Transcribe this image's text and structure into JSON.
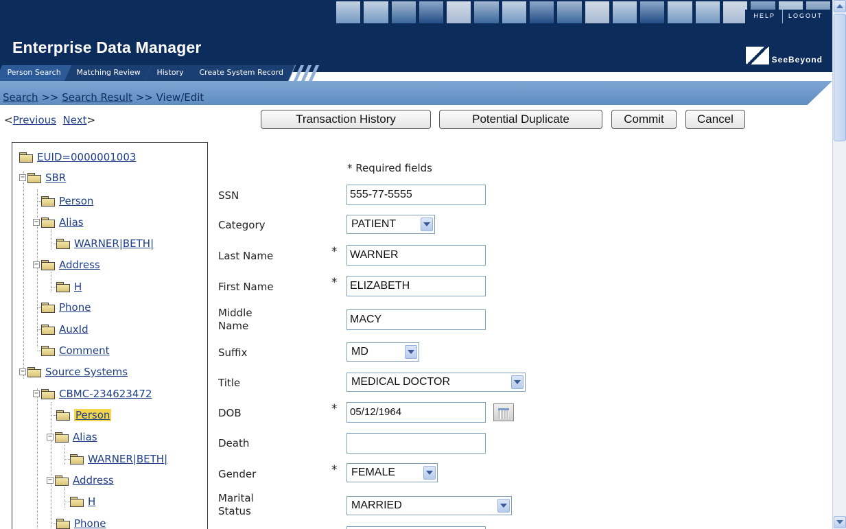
{
  "header": {
    "app_title": "Enterprise Data Manager",
    "help_label": "HELP",
    "logout_label": "LOGOUT",
    "logo_text": "SeeBeyond"
  },
  "tabs": [
    {
      "label": "Person Search",
      "active": true
    },
    {
      "label": "Matching Review"
    },
    {
      "label": "History"
    },
    {
      "label": "Create System Record"
    }
  ],
  "breadcrumb": {
    "search": "Search",
    "sep1": ">>",
    "search_result": "Search Result",
    "sep2": ">>",
    "current": "View/Edit"
  },
  "toolbar": {
    "previous": "Previous",
    "next": "Next",
    "buttons": {
      "transaction_history": "Transaction History",
      "potential_duplicate": "Potential Duplicate",
      "commit": "Commit",
      "cancel": "Cancel"
    }
  },
  "tree": {
    "euid": "EUID=0000001003",
    "sbr": "SBR",
    "sbr_person": "Person",
    "sbr_alias": "Alias",
    "sbr_alias_value": "WARNER|BETH|",
    "sbr_address": "Address",
    "sbr_address_h": "H",
    "sbr_phone": "Phone",
    "sbr_auxid": "AuxId",
    "sbr_comment": "Comment",
    "source_systems": "Source Systems",
    "system_record": "CBMC-234623472",
    "src_person": "Person",
    "src_alias": "Alias",
    "src_alias_value": "WARNER|BETH|",
    "src_address": "Address",
    "src_address_h": "H",
    "src_phone": "Phone"
  },
  "form": {
    "required_note": "* Required fields",
    "required_mark": "*",
    "fields": {
      "ssn": {
        "label": "SSN",
        "value": "555-77-5555"
      },
      "category": {
        "label": "Category",
        "value": "PATIENT"
      },
      "last_name": {
        "label": "Last Name",
        "value": "WARNER",
        "required": true
      },
      "first_name": {
        "label": "First Name",
        "value": "ELIZABETH",
        "required": true
      },
      "middle_name": {
        "label": "Middle Name",
        "value": "MACY"
      },
      "suffix": {
        "label": "Suffix",
        "value": "MD"
      },
      "title": {
        "label": "Title",
        "value": "MEDICAL DOCTOR"
      },
      "dob": {
        "label": "DOB",
        "value": "05/12/1964",
        "required": true
      },
      "death": {
        "label": "Death",
        "value": ""
      },
      "gender": {
        "label": "Gender",
        "value": "FEMALE",
        "required": true
      },
      "marital_status": {
        "label": "Marital Status",
        "value": "MARRIED"
      }
    }
  },
  "icons": {
    "folder": "folder-icon",
    "calendar": "calendar-icon",
    "dropdown": "chevron-down-icon"
  }
}
